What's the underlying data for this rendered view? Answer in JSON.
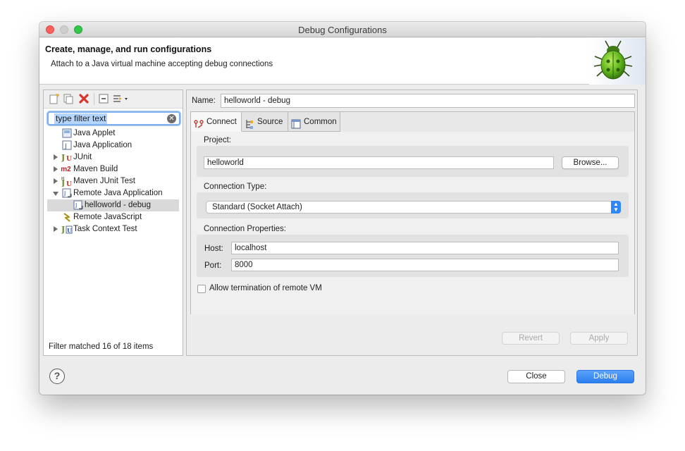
{
  "window": {
    "title": "Debug Configurations"
  },
  "banner": {
    "title": "Create, manage, and run configurations",
    "message": "Attach to a Java virtual machine accepting debug connections"
  },
  "left_panel": {
    "filter_placeholder": "type filter text",
    "tree": [
      {
        "label": "Java Applet",
        "icon": "java-applet-icon",
        "expander": "none",
        "indent": 1
      },
      {
        "label": "Java Application",
        "icon": "java-application-icon",
        "expander": "none",
        "indent": 1
      },
      {
        "label": "JUnit",
        "icon": "junit-icon",
        "expander": "collapsed",
        "indent": 1
      },
      {
        "label": "Maven Build",
        "icon": "maven-m2-icon",
        "expander": "collapsed",
        "indent": 1
      },
      {
        "label": "Maven JUnit Test",
        "icon": "maven-junit-icon",
        "expander": "collapsed",
        "indent": 1
      },
      {
        "label": "Remote Java Application",
        "icon": "remote-java-app-icon",
        "expander": "expanded",
        "indent": 1
      },
      {
        "label": "helloworld - debug",
        "icon": "remote-java-config-icon",
        "expander": "none",
        "indent": 2,
        "selected": true
      },
      {
        "label": "Remote JavaScript",
        "icon": "remote-javascript-icon",
        "expander": "none",
        "indent": 1
      },
      {
        "label": "Task Context Test",
        "icon": "task-context-icon",
        "expander": "collapsed",
        "indent": 1
      }
    ],
    "status": "Filter matched 16 of 18 items"
  },
  "config": {
    "name_label": "Name:",
    "name_value": "helloworld - debug",
    "tabs": [
      {
        "label": "Connect",
        "icon": "connect-icon",
        "active": true
      },
      {
        "label": "Source",
        "icon": "source-icon",
        "active": false
      },
      {
        "label": "Common",
        "icon": "common-icon",
        "active": false
      }
    ],
    "project_label": "Project:",
    "project_value": "helloworld",
    "browse_label": "Browse...",
    "connection_type_label": "Connection Type:",
    "connection_type_value": "Standard (Socket Attach)",
    "connection_props_label": "Connection Properties:",
    "host_label": "Host:",
    "host_value": "localhost",
    "port_label": "Port:",
    "port_value": "8000",
    "allow_termination_label": "Allow termination of remote VM",
    "allow_termination_checked": false,
    "revert_label": "Revert",
    "apply_label": "Apply"
  },
  "footer": {
    "help_symbol": "?",
    "close_label": "Close",
    "debug_label": "Debug"
  },
  "colors": {
    "accent": "#2f86f6",
    "filter_highlight": "#b4d5fe"
  }
}
